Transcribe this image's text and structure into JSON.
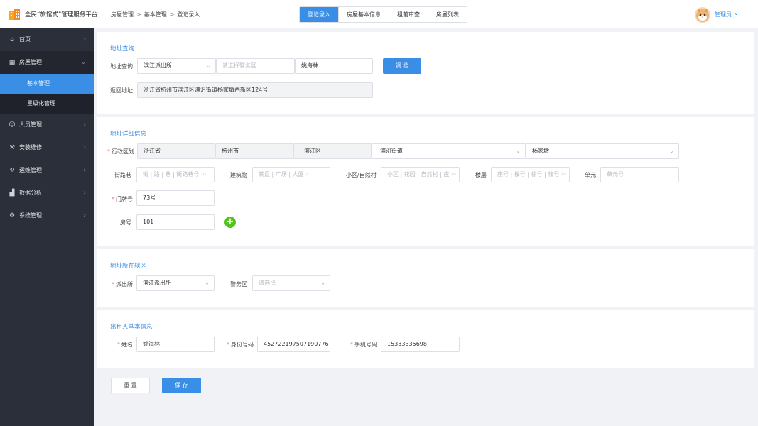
{
  "header": {
    "app_title": "全民“旅馆式”管理服务平台",
    "breadcrumb": [
      "房屋管理",
      "基本管理",
      "登记录入"
    ],
    "breadcrumb_sep": ">",
    "tabs": [
      {
        "label": "登记录入",
        "active": true
      },
      {
        "label": "房屋基本信息",
        "active": false
      },
      {
        "label": "租前审查",
        "active": false
      },
      {
        "label": "房屋列表",
        "active": false
      }
    ],
    "user_name": "管理员",
    "user_caret": "⌄"
  },
  "sidebar": {
    "items": [
      {
        "label": "首页",
        "icon": "home-icon"
      },
      {
        "label": "房屋管理",
        "icon": "building-icon"
      },
      {
        "label": "人员管理",
        "icon": "user-icon"
      },
      {
        "label": "安装维修",
        "icon": "wrench-icon"
      },
      {
        "label": "运维管理",
        "icon": "refresh-icon"
      },
      {
        "label": "数据分析",
        "icon": "chart-icon"
      },
      {
        "label": "系统管理",
        "icon": "gear-icon"
      }
    ],
    "sub_items": [
      {
        "label": "基本管理",
        "active": true
      },
      {
        "label": "星级化管理",
        "active": false
      }
    ],
    "chev": "›",
    "chev_open": "⌄"
  },
  "address_query": {
    "title": "地址查询",
    "label": "地址查询",
    "station": "滨江派出所",
    "police_zone_placeholder": "请选择警务区",
    "name": "姚海林",
    "query_button": "调 档",
    "return_label": "返回地址",
    "return_value": "浙江省杭州市滨江区浦沿街道杨家墩西新区124号"
  },
  "address_detail": {
    "title": "地址详细信息",
    "region_label": "行政区划",
    "province": "浙江省",
    "city": "杭州市",
    "district": "滨江区",
    "street": "浦沿街道",
    "community": "杨家墩",
    "road_label": "街路巷",
    "road_placeholder": "街 | 路 | 巷 | 街路巷号 ···",
    "building_label": "建筑物",
    "building_placeholder": "转盘 | 广场 | 大厦 ···",
    "estate_label": "小区/自然村",
    "estate_placeholder": "小区 | 花园 | 自然村 | 庄 ···",
    "floor_label": "楼层",
    "floor_placeholder": "座号 | 楼号 | 栋号 | 幢号 ···",
    "unit_label": "单元",
    "unit_placeholder": "单元号",
    "door_label": "门牌号",
    "door_value": "73号",
    "room_label": "房号",
    "room_value": "101",
    "add_symbol": "+"
  },
  "jurisdiction": {
    "title": "地址所在辖区",
    "station_label": "派出所",
    "station_value": "滨江派出所",
    "zone_label": "警务区",
    "zone_placeholder": "请选择"
  },
  "landlord": {
    "title": "出租人基本信息",
    "name_label": "姓名",
    "name_value": "姚海林",
    "id_label": "身份号码",
    "id_value": "452722197507190776",
    "phone_label": "手机号码",
    "phone_value": "15333335698"
  },
  "actions": {
    "reset": "重 置",
    "save": "保 存"
  },
  "required_mark": "*",
  "dropdown_caret": "⌄",
  "colors": {
    "primary": "#3a8ee6",
    "sidebar": "#2b2f3a",
    "required": "#f56c6c",
    "add": "#52c41a"
  }
}
